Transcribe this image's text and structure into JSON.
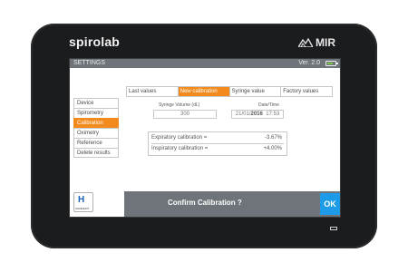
{
  "device": {
    "brand": "spirolab",
    "logo_text": "MIR"
  },
  "screen": {
    "title": "SETTINGS",
    "version": "Ver. 2.0",
    "battery_level": 0.7
  },
  "sidebar": {
    "items": [
      {
        "label": "Device",
        "active": false
      },
      {
        "label": "Spirometry",
        "active": false
      },
      {
        "label": "Calibration",
        "active": true
      },
      {
        "label": "Oximetry",
        "active": false
      },
      {
        "label": "Reference",
        "active": false
      },
      {
        "label": "Delete results",
        "active": false
      }
    ]
  },
  "tabs": [
    {
      "label": "Last values",
      "active": false
    },
    {
      "label": "New calibration",
      "active": true
    },
    {
      "label": "Syringe value",
      "active": false
    },
    {
      "label": "Factory values",
      "active": false
    }
  ],
  "syringe": {
    "label": "Syringe Volume (dL)",
    "value": "300"
  },
  "datetime": {
    "label": "Date/Time",
    "date_prefix": "21/01/",
    "year": "2016",
    "time": "17:53"
  },
  "calibration": {
    "expiratory_label": "Expiratory calibration =",
    "expiratory_value": "-3.67%",
    "inspiratory_label": "Inspiratory calibration =",
    "inspiratory_value": "+4.00%"
  },
  "footer": {
    "save_label": "SAVE/EXIT",
    "confirm_text": "Confirm Calibration ?",
    "ok_label": "OK"
  },
  "colors": {
    "accent": "#f28a1d",
    "ok_button": "#1e9be8",
    "bar": "#6f747a"
  }
}
